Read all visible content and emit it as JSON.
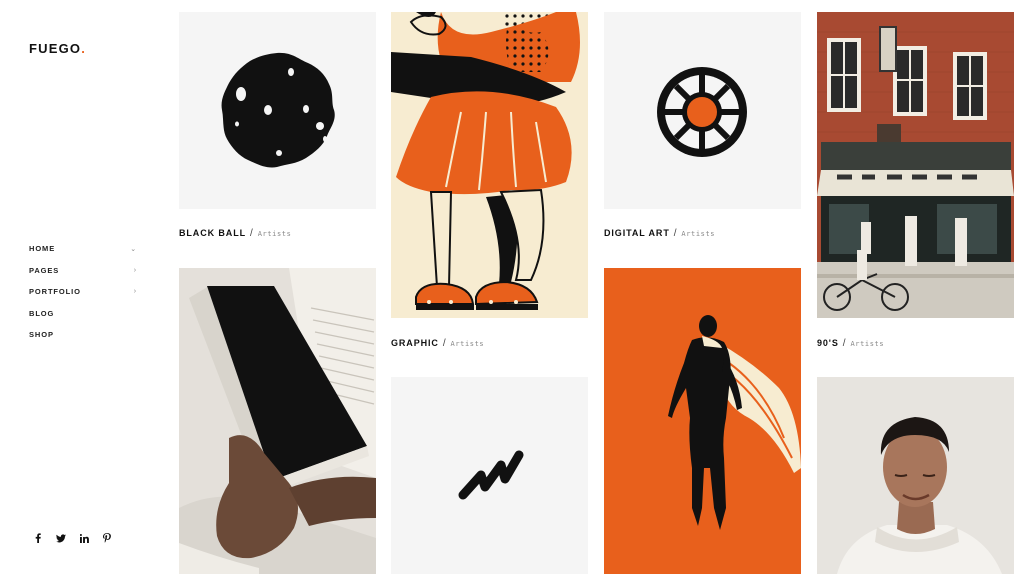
{
  "brand": {
    "name": "FUEGO",
    "dot": ".",
    "accent": "#e8601c"
  },
  "nav": {
    "items": [
      {
        "label": "HOME",
        "arrow": "⌄"
      },
      {
        "label": "PAGES",
        "arrow": "›"
      },
      {
        "label": "PORTFOLIO",
        "arrow": "›"
      },
      {
        "label": "BLOG",
        "arrow": ""
      },
      {
        "label": "SHOP",
        "arrow": ""
      }
    ]
  },
  "social": [
    "facebook-icon",
    "twitter-icon",
    "linkedin-icon",
    "pinterest-icon"
  ],
  "portfolio": {
    "separator": "/",
    "items": [
      {
        "title": "BLACK BALL",
        "category": "Artists"
      },
      {
        "title": "GRAPHIC",
        "category": "Artists"
      },
      {
        "title": "DIGITAL ART",
        "category": "Artists"
      },
      {
        "title": "90'S",
        "category": "Artists"
      }
    ]
  },
  "colors": {
    "orange": "#e8601c",
    "tile_gray": "#f5f5f5",
    "cream": "#f7ecd1",
    "brick": "#a84a32"
  }
}
